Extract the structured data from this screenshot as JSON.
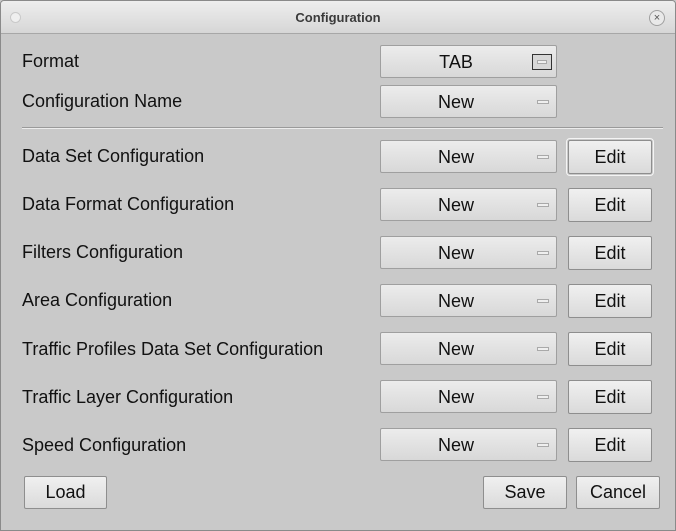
{
  "window": {
    "title": "Configuration",
    "close_glyph": "×"
  },
  "rows": [
    {
      "label": "Format",
      "value": "TAB",
      "edit": ""
    },
    {
      "label": "Configuration Name",
      "value": "New",
      "edit": ""
    },
    {
      "label": "Data Set Configuration",
      "value": "New",
      "edit": "Edit"
    },
    {
      "label": "Data Format Configuration",
      "value": "New",
      "edit": "Edit"
    },
    {
      "label": "Filters Configuration",
      "value": "New",
      "edit": "Edit"
    },
    {
      "label": "Area Configuration",
      "value": "New",
      "edit": "Edit"
    },
    {
      "label": "Traffic Profiles Data Set Configuration",
      "value": "New",
      "edit": "Edit"
    },
    {
      "label": "Traffic Layer Configuration",
      "value": "New",
      "edit": "Edit"
    },
    {
      "label": "Speed Configuration",
      "value": "New",
      "edit": "Edit"
    }
  ],
  "buttons": {
    "load": "Load",
    "save": "Save",
    "cancel": "Cancel"
  },
  "icons": {
    "combo_indicator": "dropdown-indicator-icon",
    "close": "close-icon"
  }
}
